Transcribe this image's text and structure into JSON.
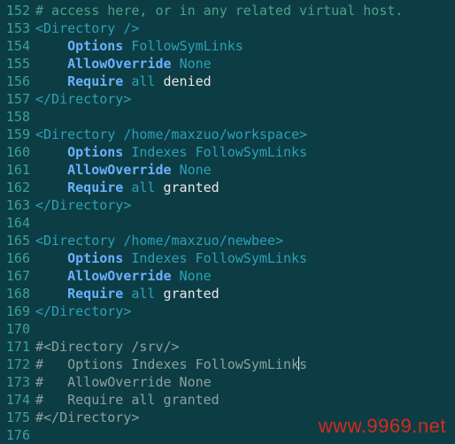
{
  "watermark": "www.9969.net",
  "lines": [
    {
      "n": "152",
      "seg": [
        {
          "c": "t-cmt",
          "t": "# access here, or in any related virtual host."
        }
      ]
    },
    {
      "n": "153",
      "seg": [
        {
          "c": "t-tag",
          "t": "<Directory "
        },
        {
          "c": "t-path",
          "t": "/"
        },
        {
          "c": "t-tag",
          "t": ">"
        }
      ]
    },
    {
      "n": "154",
      "seg": [
        {
          "c": "",
          "t": "    "
        },
        {
          "c": "t-attr",
          "t": "Options"
        },
        {
          "c": "",
          "t": " "
        },
        {
          "c": "t-val",
          "t": "FollowSymLinks"
        }
      ]
    },
    {
      "n": "155",
      "seg": [
        {
          "c": "",
          "t": "    "
        },
        {
          "c": "t-attr",
          "t": "AllowOverride"
        },
        {
          "c": "",
          "t": " "
        },
        {
          "c": "t-val",
          "t": "None"
        }
      ]
    },
    {
      "n": "156",
      "seg": [
        {
          "c": "",
          "t": "    "
        },
        {
          "c": "t-attr",
          "t": "Require"
        },
        {
          "c": "",
          "t": " "
        },
        {
          "c": "t-val",
          "t": "all"
        },
        {
          "c": "",
          "t": " "
        },
        {
          "c": "t-lit",
          "t": "denied"
        }
      ]
    },
    {
      "n": "157",
      "seg": [
        {
          "c": "t-tag",
          "t": "</Directory>"
        }
      ]
    },
    {
      "n": "158",
      "seg": [
        {
          "c": "",
          "t": ""
        }
      ]
    },
    {
      "n": "159",
      "seg": [
        {
          "c": "t-tag",
          "t": "<Directory "
        },
        {
          "c": "t-path",
          "t": "/home/maxzuo/workspace"
        },
        {
          "c": "t-tag",
          "t": ">"
        }
      ]
    },
    {
      "n": "160",
      "seg": [
        {
          "c": "",
          "t": "    "
        },
        {
          "c": "t-attr",
          "t": "Options"
        },
        {
          "c": "",
          "t": " "
        },
        {
          "c": "t-val",
          "t": "Indexes"
        },
        {
          "c": "",
          "t": " "
        },
        {
          "c": "t-val",
          "t": "FollowSymLinks"
        }
      ]
    },
    {
      "n": "161",
      "seg": [
        {
          "c": "",
          "t": "    "
        },
        {
          "c": "t-attr",
          "t": "AllowOverride"
        },
        {
          "c": "",
          "t": " "
        },
        {
          "c": "t-val",
          "t": "None"
        }
      ]
    },
    {
      "n": "162",
      "seg": [
        {
          "c": "",
          "t": "    "
        },
        {
          "c": "t-attr",
          "t": "Require"
        },
        {
          "c": "",
          "t": " "
        },
        {
          "c": "t-val",
          "t": "all"
        },
        {
          "c": "",
          "t": " "
        },
        {
          "c": "t-lit",
          "t": "granted"
        }
      ]
    },
    {
      "n": "163",
      "seg": [
        {
          "c": "t-tag",
          "t": "</Directory>"
        }
      ]
    },
    {
      "n": "164",
      "seg": [
        {
          "c": "",
          "t": ""
        }
      ]
    },
    {
      "n": "165",
      "seg": [
        {
          "c": "t-tag",
          "t": "<Directory "
        },
        {
          "c": "t-path",
          "t": "/home/maxzuo/newbee"
        },
        {
          "c": "t-tag",
          "t": ">"
        }
      ]
    },
    {
      "n": "166",
      "seg": [
        {
          "c": "",
          "t": "    "
        },
        {
          "c": "t-attr",
          "t": "Options"
        },
        {
          "c": "",
          "t": " "
        },
        {
          "c": "t-val",
          "t": "Indexes"
        },
        {
          "c": "",
          "t": " "
        },
        {
          "c": "t-val",
          "t": "FollowSymLinks"
        }
      ]
    },
    {
      "n": "167",
      "seg": [
        {
          "c": "",
          "t": "    "
        },
        {
          "c": "t-attr",
          "t": "AllowOverride"
        },
        {
          "c": "",
          "t": " "
        },
        {
          "c": "t-val",
          "t": "None"
        }
      ]
    },
    {
      "n": "168",
      "seg": [
        {
          "c": "",
          "t": "    "
        },
        {
          "c": "t-attr",
          "t": "Require"
        },
        {
          "c": "",
          "t": " "
        },
        {
          "c": "t-val",
          "t": "all"
        },
        {
          "c": "",
          "t": " "
        },
        {
          "c": "t-lit",
          "t": "granted"
        }
      ]
    },
    {
      "n": "169",
      "seg": [
        {
          "c": "t-tag",
          "t": "</Directory>"
        }
      ]
    },
    {
      "n": "170",
      "seg": [
        {
          "c": "",
          "t": ""
        }
      ]
    },
    {
      "n": "171",
      "seg": [
        {
          "c": "t-cmt2",
          "t": "#<Directory /srv/>"
        }
      ]
    },
    {
      "n": "172",
      "seg": [
        {
          "c": "t-cmt2",
          "t": "#   Options Indexes FollowSymLink"
        },
        {
          "c": "",
          "t": "",
          "cursor": true
        },
        {
          "c": "t-cmt2",
          "t": "s"
        }
      ]
    },
    {
      "n": "173",
      "seg": [
        {
          "c": "t-cmt2",
          "t": "#   AllowOverride None"
        }
      ]
    },
    {
      "n": "174",
      "seg": [
        {
          "c": "t-cmt2",
          "t": "#   Require all granted"
        }
      ]
    },
    {
      "n": "175",
      "seg": [
        {
          "c": "t-cmt2",
          "t": "#</Directory>"
        }
      ]
    },
    {
      "n": "176",
      "seg": [
        {
          "c": "",
          "t": ""
        }
      ]
    }
  ]
}
